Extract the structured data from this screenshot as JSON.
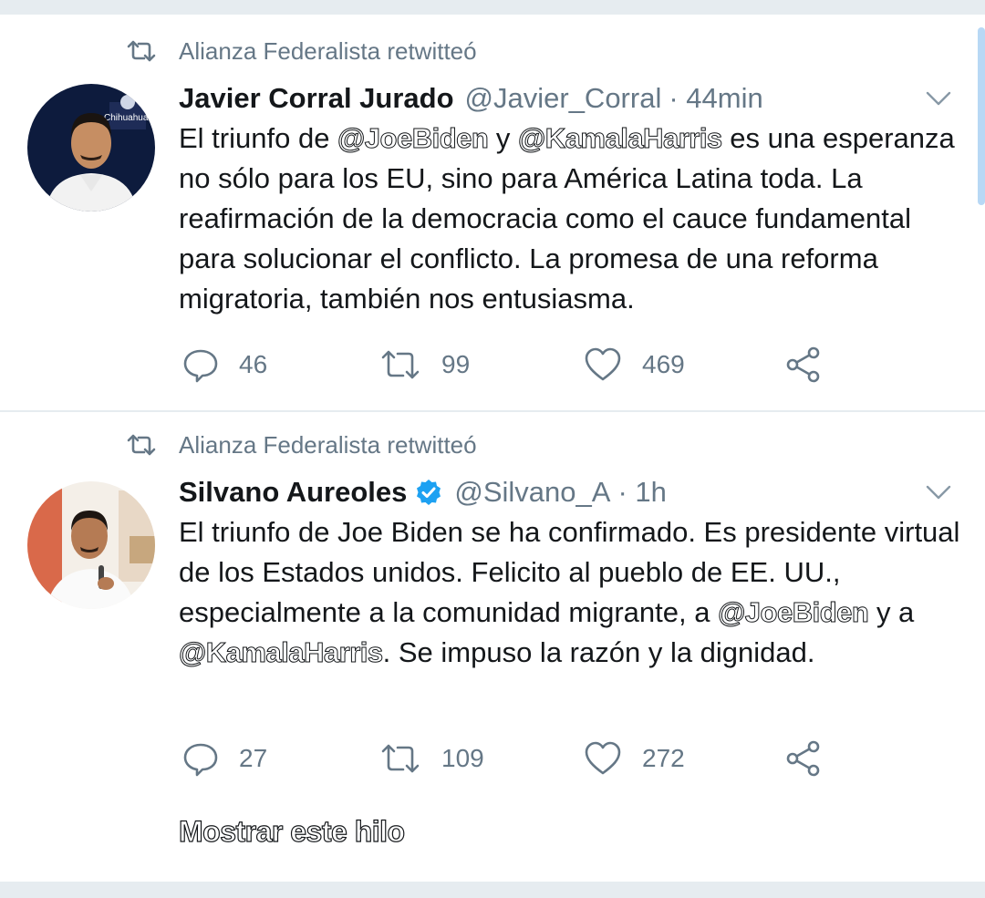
{
  "tweets": [
    {
      "retweeted_by": "Alianza Federalista retwitteó",
      "author_name": "Javier Corral Jurado",
      "author_handle": "@Javier_Corral",
      "time": "· 44min",
      "avatar_icon": "avatar-javier-corral",
      "text_parts": [
        "El triunfo de ",
        "@JoeBiden",
        " y ",
        "@KamalaHarris",
        " es una esperanza no sólo para los EU, sino para América Latina toda. La reafirmación de la democracia como el cauce fundamental para solucionar el conflicto. La promesa de una reforma migratoria, también nos entusiasma."
      ],
      "replies": "46",
      "retweets": "99",
      "likes": "469"
    },
    {
      "retweeted_by": "Alianza Federalista retwitteó",
      "author_name": "Silvano Aureoles",
      "author_handle": "@Silvano_A",
      "time": "· 1h",
      "verified": true,
      "avatar_icon": "avatar-silvano-aureoles",
      "text_parts": [
        "El triunfo de Joe Biden se ha confirmado. Es presidente virtual de los Estados unidos. Felicito al pueblo de EE. UU., especialmente a la comunidad migrante, a ",
        "@JoeBiden",
        "  y a ",
        "@KamalaHarris",
        ". Se impuso la razón y la dignidad."
      ],
      "replies": "27",
      "retweets": "109",
      "likes": "272",
      "show_thread": "Mostrar este hilo"
    }
  ],
  "colors": {
    "text": "#14171a",
    "secondary": "#657786",
    "divider": "#e6ecf0",
    "verified": "#1da1f2"
  }
}
